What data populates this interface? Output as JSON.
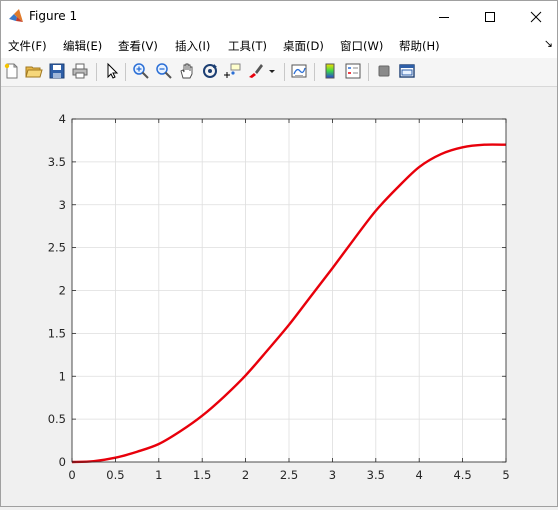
{
  "window": {
    "title": "Figure 1",
    "controls": {
      "minimize": "minimize-icon",
      "maximize": "maximize-icon",
      "close": "close-icon"
    }
  },
  "menu": {
    "items": [
      "文件(F)",
      "编辑(E)",
      "查看(V)",
      "插入(I)",
      "工具(T)",
      "桌面(D)",
      "窗口(W)",
      "帮助(H)"
    ],
    "overflow": "↘"
  },
  "toolbar": {
    "icons": [
      "new-figure-icon",
      "open-file-icon",
      "save-icon",
      "print-icon",
      "select-pointer-icon",
      "zoom-in-icon",
      "zoom-out-icon",
      "pan-hand-icon",
      "rotate-3d-icon",
      "data-cursor-icon",
      "brush-icon",
      "link-plot-icon",
      "colorbar-icon",
      "legend-icon",
      "hide-plot-tools-icon",
      "show-plot-tools-icon"
    ],
    "colors": {
      "accent": "#2b6fd6"
    }
  },
  "chart_data": {
    "type": "line",
    "title": "",
    "xlabel": "",
    "ylabel": "",
    "xlim": [
      0,
      5
    ],
    "ylim": [
      0,
      4
    ],
    "xticks": [
      "0",
      "0.5",
      "1",
      "1.5",
      "2",
      "2.5",
      "3",
      "3.5",
      "4",
      "4.5",
      "5"
    ],
    "yticks": [
      "0",
      "0.5",
      "1",
      "1.5",
      "2",
      "2.5",
      "3",
      "3.5",
      "4"
    ],
    "grid": true,
    "series": [
      {
        "color": "#e8000b",
        "x": [
          0,
          0.25,
          0.5,
          0.75,
          1,
          1.25,
          1.5,
          1.75,
          2,
          2.25,
          2.5,
          2.75,
          3,
          3.25,
          3.5,
          3.75,
          4,
          4.25,
          4.5,
          4.75,
          5
        ],
        "y": [
          0,
          0.01,
          0.05,
          0.12,
          0.21,
          0.36,
          0.54,
          0.76,
          1.01,
          1.3,
          1.6,
          1.93,
          2.26,
          2.6,
          2.93,
          3.2,
          3.44,
          3.59,
          3.67,
          3.7,
          3.7
        ]
      }
    ]
  }
}
